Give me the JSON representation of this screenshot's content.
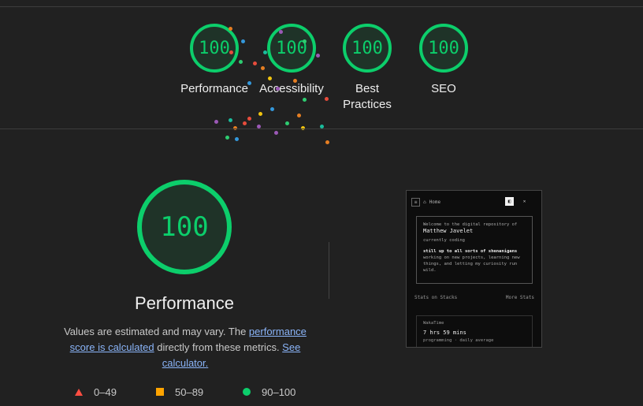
{
  "summary": {
    "gauges": [
      {
        "score": "100",
        "label": "Performance"
      },
      {
        "score": "100",
        "label": "Accessibility"
      },
      {
        "score": "100",
        "label": "Best Practices"
      },
      {
        "score": "100",
        "label": "SEO"
      }
    ]
  },
  "category": {
    "score": "100",
    "title": "Performance",
    "desc_before": "Values are estimated and may vary. The ",
    "link_score": "performance score is calculated",
    "desc_middle": " directly from these metrics. ",
    "link_calc": "See calculator."
  },
  "legend": [
    {
      "range": "0–49"
    },
    {
      "range": "50–89"
    },
    {
      "range": "90–100"
    }
  ],
  "colors": {
    "pass": "#0cce6b",
    "average": "#ffa400",
    "fail": "#ff4e42",
    "link": "#8ab4f8",
    "background": "#212121"
  },
  "screenshot": {
    "breadcrumb": "Home",
    "welcome": "Welcome to the digital repository of",
    "name": "Matthew Javelet",
    "status": "currently coding",
    "tagline": "still up to all sorts of shenanigans",
    "body": "working on new projects, learning new things, and letting my curiosity run wild.",
    "stats_left": "Stats on Stacks",
    "stats_right": "More Stats",
    "wakatime": "WakaTime",
    "hours": "7 hrs 59 mins",
    "sub1": "programming",
    "sub2": "daily average"
  }
}
